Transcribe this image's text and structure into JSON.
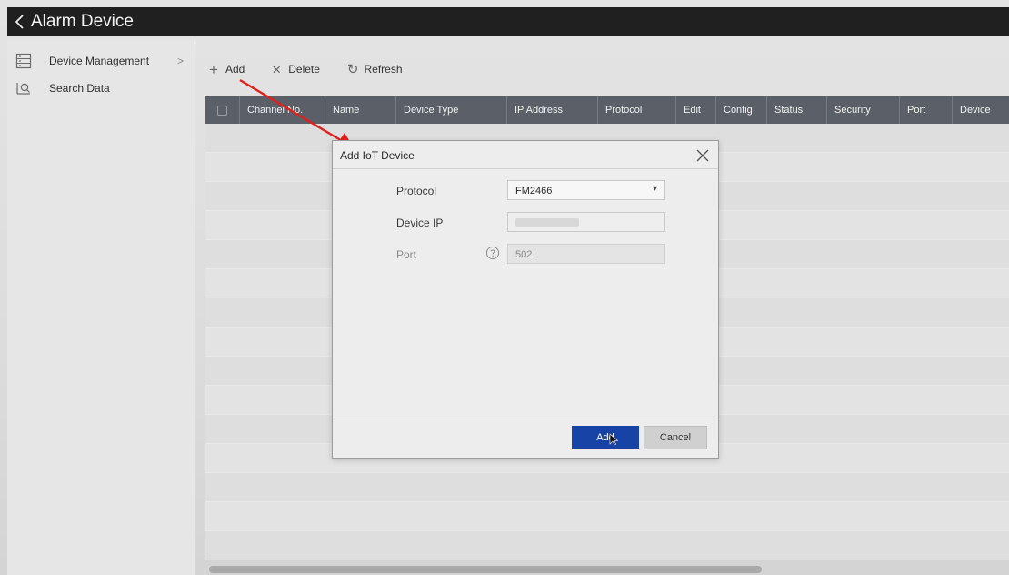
{
  "window": {
    "title": "Alarm Device"
  },
  "sidebar": {
    "items": [
      {
        "label": "Device Management",
        "icon": "device-management-icon",
        "has_submenu": true
      },
      {
        "label": "Search Data",
        "icon": "search-data-icon",
        "has_submenu": false
      }
    ]
  },
  "toolbar": {
    "add_label": "Add",
    "delete_label": "Delete",
    "refresh_label": "Refresh"
  },
  "table": {
    "columns": [
      "Channel No.",
      "Name",
      "Device Type",
      "IP Address",
      "Protocol",
      "Edit",
      "Config",
      "Status",
      "Security",
      "Port",
      "Device"
    ]
  },
  "dialog": {
    "title": "Add IoT Device",
    "protocol_label": "Protocol",
    "protocol_value": "FM2466",
    "device_ip_label": "Device IP",
    "device_ip_value": "",
    "port_label": "Port",
    "port_value": "502",
    "add_button": "Add",
    "cancel_button": "Cancel"
  },
  "colors": {
    "titlebar": "#202020",
    "table_header": "#5b6068",
    "primary_button": "#1742a6",
    "annotation_arrow": "#e0201c"
  }
}
